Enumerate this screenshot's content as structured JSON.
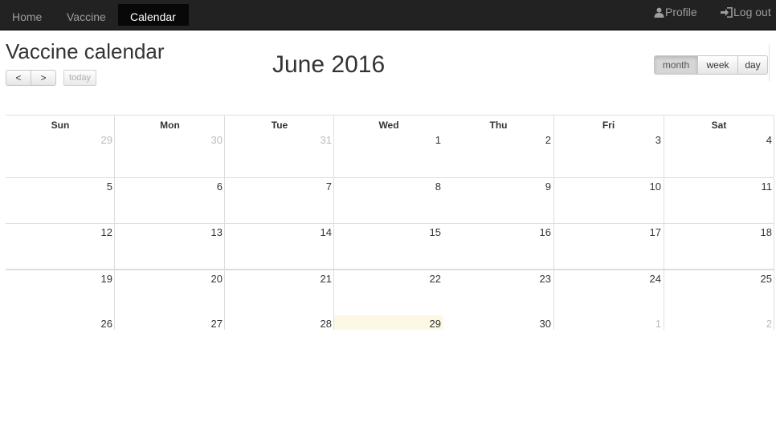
{
  "nav": {
    "items": [
      "Home",
      "Vaccine",
      "Calendar"
    ],
    "active": "Calendar",
    "profile": "Profile",
    "logout": "Log out"
  },
  "page": {
    "title": "Vaccine calendar"
  },
  "toolbar": {
    "prev": "<",
    "next": ">",
    "today": "today",
    "title": "June 2016",
    "views": [
      "month",
      "week",
      "day"
    ],
    "active_view": "month"
  },
  "calendar": {
    "headers": [
      "Sun",
      "Mon",
      "Tue",
      "Wed",
      "Thu",
      "Fri",
      "Sat"
    ],
    "weeks": [
      [
        "29",
        "30",
        "31",
        "1",
        "2",
        "3",
        "4"
      ],
      [
        "5",
        "6",
        "7",
        "8",
        "9",
        "10",
        "11"
      ],
      [
        "12",
        "13",
        "14",
        "15",
        "16",
        "17",
        "18"
      ],
      [
        "19",
        "20",
        "21",
        "22",
        "23",
        "24",
        "25"
      ],
      [
        "26",
        "27",
        "28",
        "29",
        "30",
        "1",
        "2"
      ]
    ],
    "today": "29",
    "highlight_color": "#fcf8e3"
  }
}
